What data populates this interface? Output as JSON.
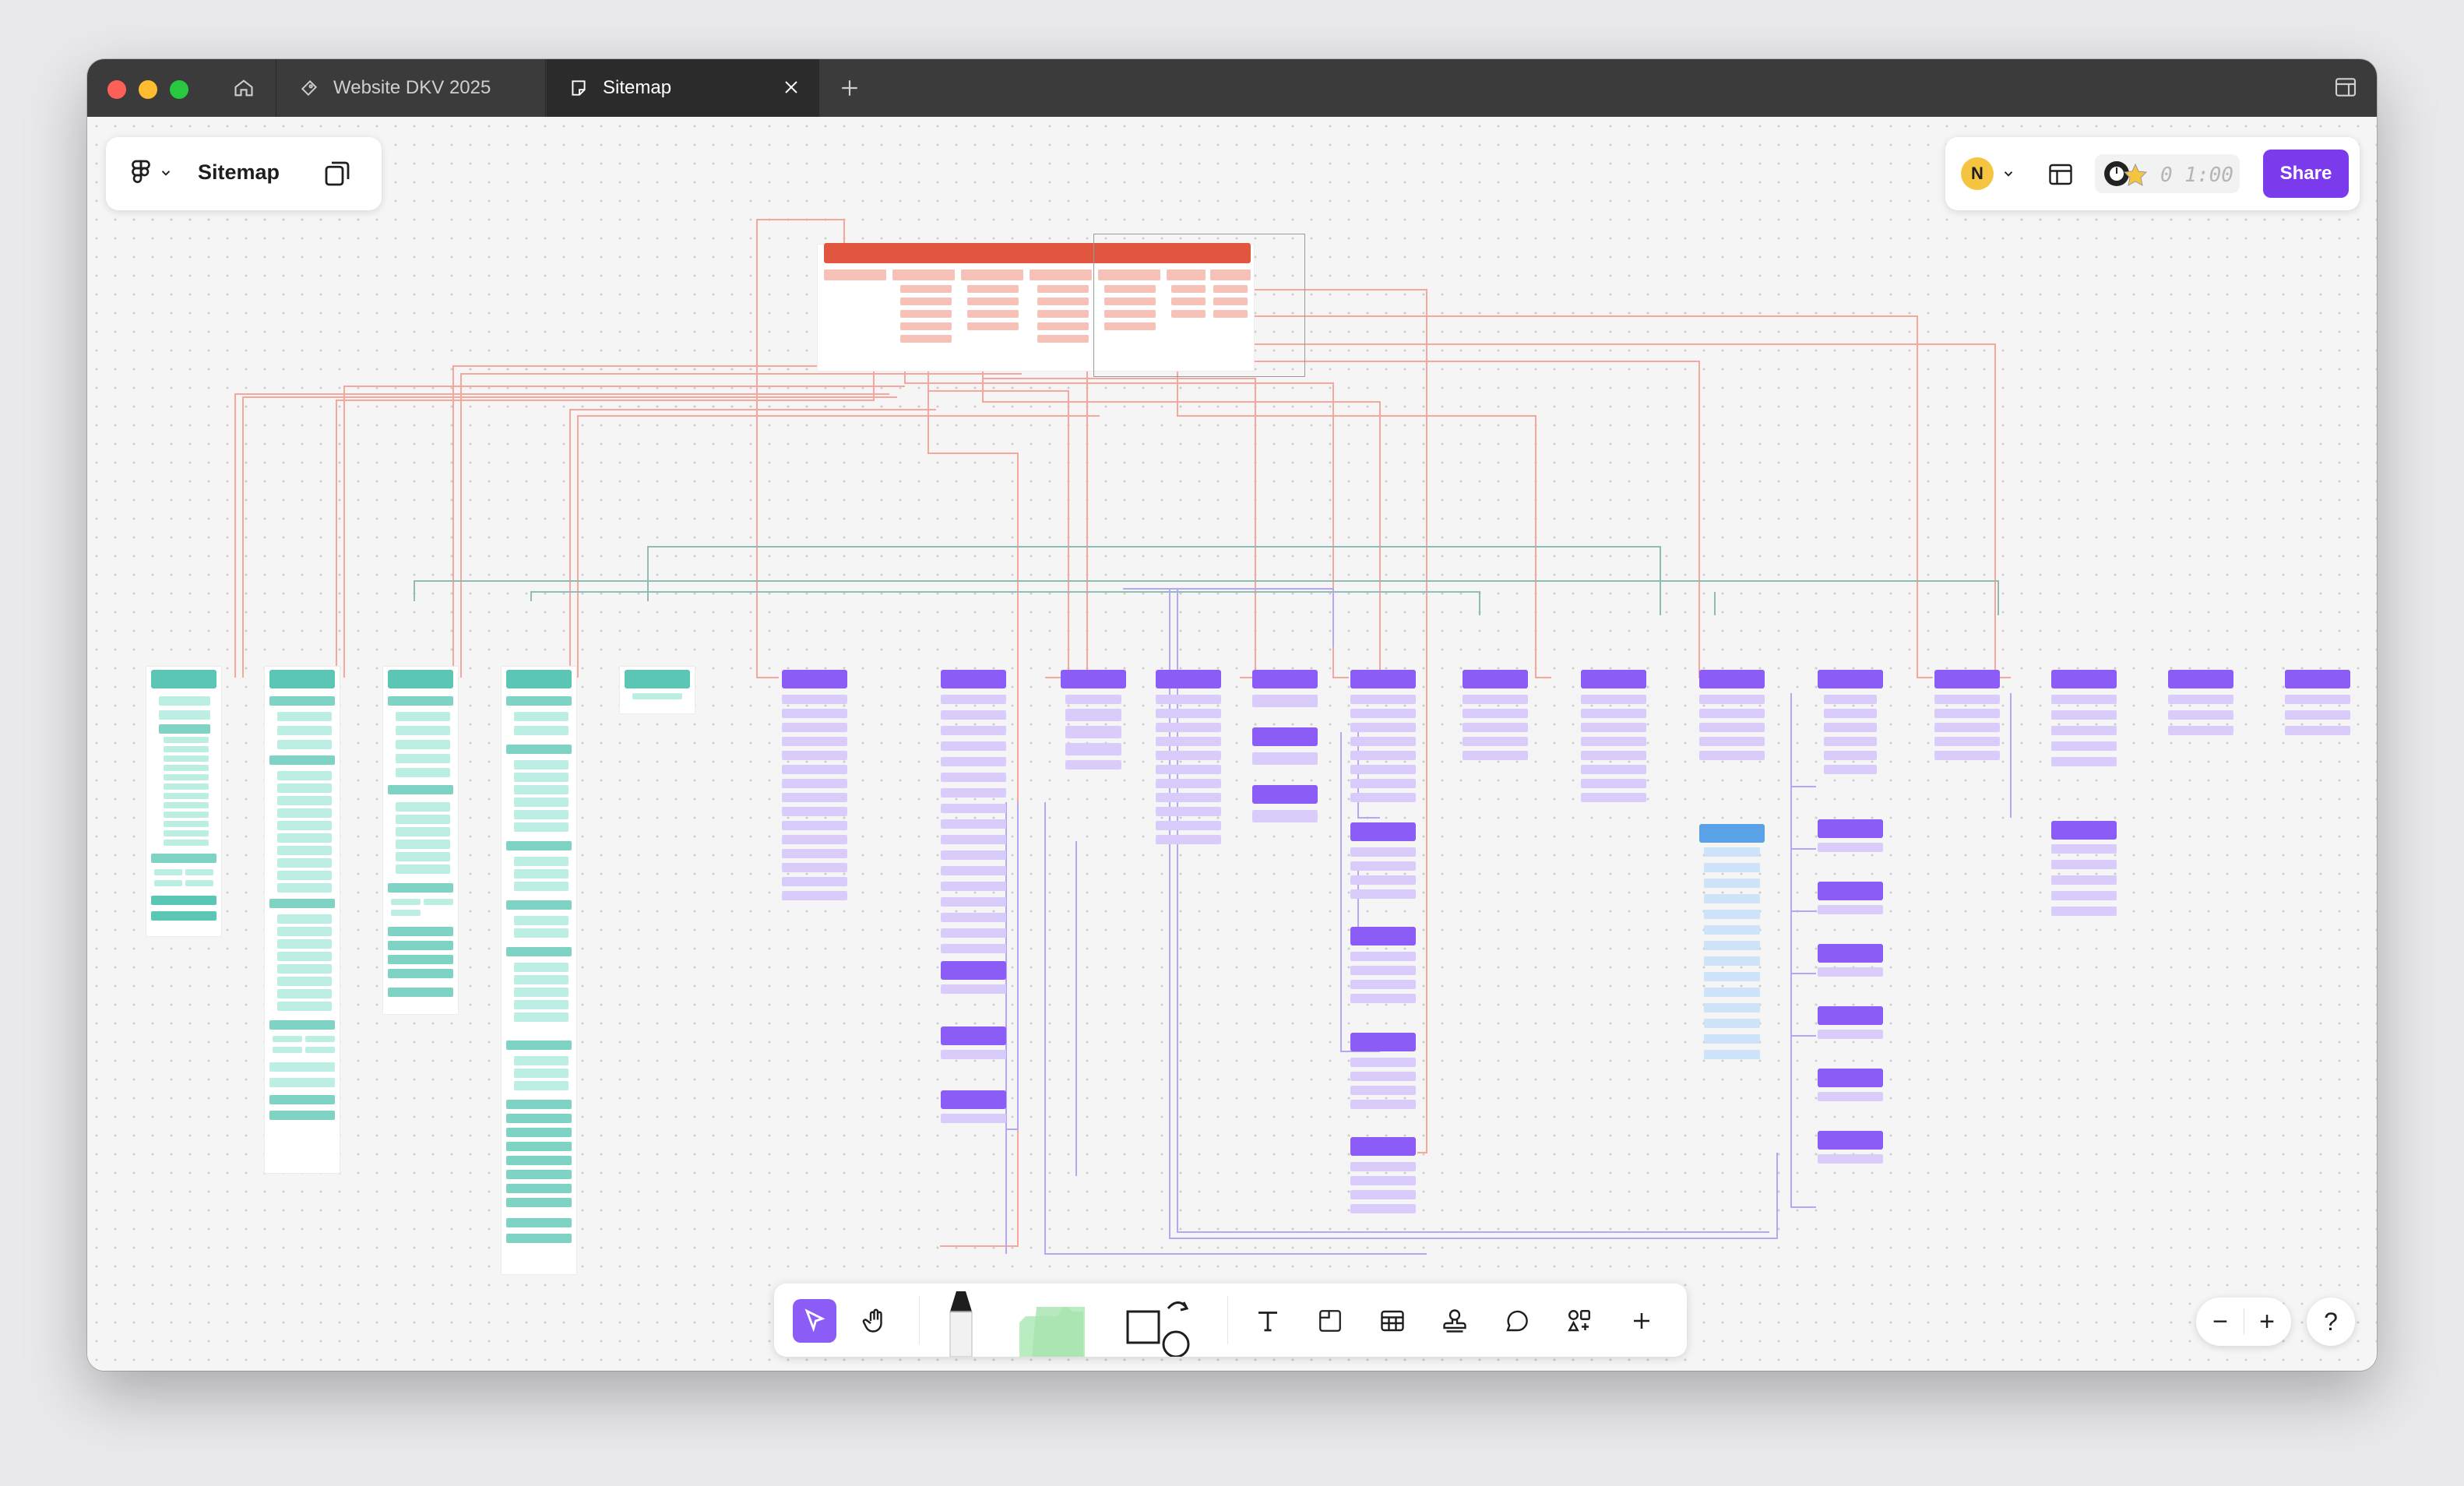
{
  "tabs": [
    {
      "label": "Website DKV 2025"
    },
    {
      "label": "Sitemap"
    }
  ],
  "file": {
    "name": "Sitemap"
  },
  "user": {
    "initial": "N"
  },
  "timer": {
    "value": "0 1:00"
  },
  "share": {
    "label": "Share"
  },
  "colors": {
    "teal": "#5cc6b4",
    "purple": "#8b5cf6",
    "red": "#e0563f",
    "blue": "#5aa2e8",
    "share": "#7c3aed",
    "titlebar": "#3b3b3b"
  },
  "icons": {
    "home": "home-icon",
    "file": "figjam-file-icon",
    "close": "close-icon",
    "new_tab": "plus-icon",
    "panel": "sidebar-toggle-icon",
    "menu": "figma-menu-icon",
    "pages": "pages-icon",
    "layout": "layout-icon",
    "timer": "timer-icon"
  },
  "tools": [
    {
      "name": "select-tool",
      "icon": "cursor-icon"
    },
    {
      "name": "hand-tool",
      "icon": "hand-icon"
    },
    {
      "name": "marker-tool",
      "icon": "marker-icon"
    },
    {
      "name": "sticky-note-tool",
      "icon": "sticky-note-icon"
    },
    {
      "name": "shape-tool",
      "icon": "shape-icon"
    },
    {
      "name": "text-tool",
      "icon": "text-icon"
    },
    {
      "name": "section-tool",
      "icon": "section-icon"
    },
    {
      "name": "table-tool",
      "icon": "table-icon"
    },
    {
      "name": "stamp-tool",
      "icon": "stamp-icon"
    },
    {
      "name": "comment-tool",
      "icon": "comment-icon"
    },
    {
      "name": "widgets-tool",
      "icon": "widgets-icon"
    },
    {
      "name": "more-tool",
      "icon": "plus-icon"
    }
  ],
  "zoom": {
    "out": "−",
    "in": "+"
  },
  "help": {
    "label": "?"
  }
}
